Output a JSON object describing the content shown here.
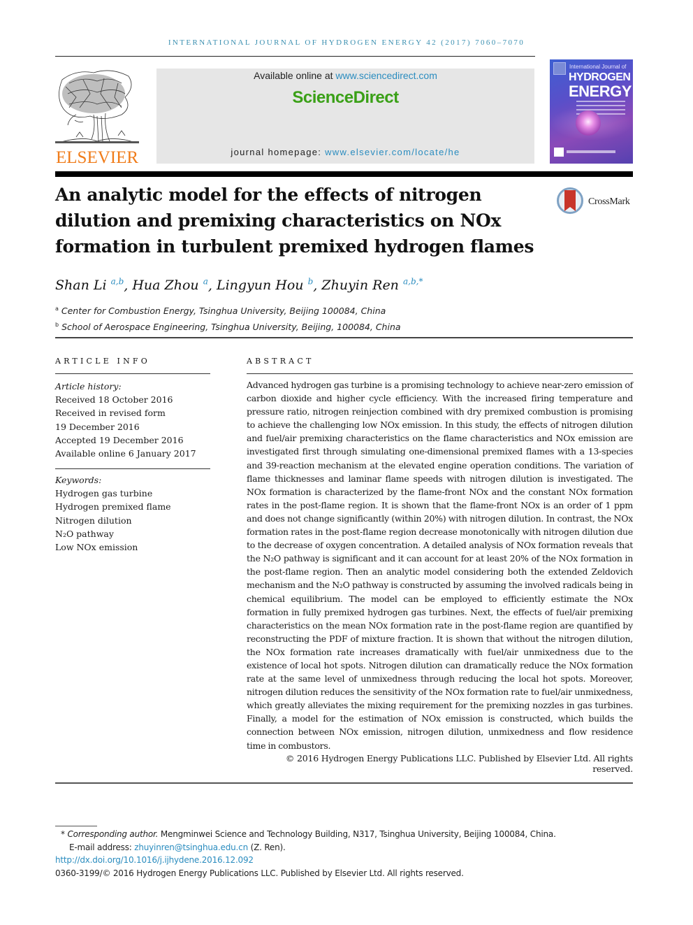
{
  "header": {
    "running_head": "INTERNATIONAL JOURNAL OF HYDROGEN ENERGY 42 (2017) 7060–7070",
    "publisher_logo_text": "ELSEVIER",
    "available_online_prefix": "Available online at ",
    "available_online_link": "www.sciencedirect.com",
    "brand": "ScienceDirect",
    "homepage_prefix": "journal homepage: ",
    "homepage_link": "www.elsevier.com/locate/he",
    "cover": {
      "line1": "International Journal of",
      "line2": "HYDROGEN",
      "line3": "ENERGY"
    },
    "colors": {
      "running_head": "#3a8fb0",
      "elsevier_orange": "#f07c1a",
      "sciencedirect_green": "#3aa017",
      "link_blue": "#2a8cbf"
    }
  },
  "article": {
    "title": "An analytic model for the effects of nitrogen dilution and premixing characteristics on NOx formation in turbulent premixed hydrogen flames",
    "crossmark_label": "CrossMark",
    "authors": [
      {
        "name": "Shan Li",
        "sup": "a,b",
        "sep": ", "
      },
      {
        "name": "Hua Zhou",
        "sup": "a",
        "sep": ", "
      },
      {
        "name": "Lingyun Hou",
        "sup": "b",
        "sep": ", "
      },
      {
        "name": "Zhuyin Ren",
        "sup": "a,b,*",
        "sep": ""
      }
    ],
    "affiliations": [
      {
        "key": "a",
        "text": "Center for Combustion Energy, Tsinghua University, Beijing 100084, China"
      },
      {
        "key": "b",
        "text": "School of Aerospace Engineering, Tsinghua University, Beijing, 100084, China"
      }
    ]
  },
  "article_info": {
    "heading": "ARTICLE INFO",
    "history_label": "Article history:",
    "history": [
      "Received 18 October 2016",
      "Received in revised form",
      "19 December 2016",
      "Accepted 19 December 2016",
      "Available online 6 January 2017"
    ],
    "keywords_label": "Keywords:",
    "keywords": [
      "Hydrogen gas turbine",
      "Hydrogen premixed flame",
      "Nitrogen dilution",
      "N₂O pathway",
      "Low NOx emission"
    ]
  },
  "abstract": {
    "heading": "ABSTRACT",
    "text": "Advanced hydrogen gas turbine is a promising technology to achieve near-zero emission of carbon dioxide and higher cycle efficiency. With the increased firing temperature and pressure ratio, nitrogen reinjection combined with dry premixed combustion is promising to achieve the challenging low NOx emission. In this study, the effects of nitrogen dilution and fuel/air premixing characteristics on the flame characteristics and NOx emission are investigated first through simulating one-dimensional premixed flames with a 13-species and 39-reaction mechanism at the elevated engine operation conditions. The variation of flame thicknesses and laminar flame speeds with nitrogen dilution is investigated. The NOx formation is characterized by the flame-front NOx and the constant NOx formation rates in the post-flame region. It is shown that the flame-front NOx is an order of 1 ppm and does not change significantly (within 20%) with nitrogen dilution. In contrast, the NOx formation rates in the post-flame region decrease monotonically with nitrogen dilution due to the decrease of oxygen concentration. A detailed analysis of NOx formation reveals that the N₂O pathway is significant and it can account for at least 20% of the NOx formation in the post-flame region. Then an analytic model considering both the extended Zeldovich mechanism and the N₂O pathway is constructed by assuming the involved radicals being in chemical equilibrium. The model can be employed to efficiently estimate the NOx formation in fully premixed hydrogen gas turbines. Next, the effects of fuel/air premixing characteristics on the mean NOx formation rate in the post-flame region are quantified by reconstructing the PDF of mixture fraction. It is shown that without the nitrogen dilution, the NOx formation rate increases dramatically with fuel/air unmixedness due to the existence of local hot spots. Nitrogen dilution can dramatically reduce the NOx formation rate at the same level of unmixedness through reducing the local hot spots. Moreover, nitrogen dilution reduces the sensitivity of the NOx formation rate to fuel/air unmixedness, which greatly alleviates the mixing requirement for the premixing nozzles in gas turbines. Finally, a model for the estimation of NOx emission is constructed, which builds the connection between NOx emission, nitrogen dilution, unmixedness and flow residence time in combustors.",
    "copyright": "© 2016 Hydrogen Energy Publications LLC. Published by Elsevier Ltd. All rights reserved."
  },
  "footnotes": {
    "corresponding_label": "Corresponding author.",
    "corresponding_marker": "*",
    "corresponding_text": " Mengminwei Science and Technology Building, N317, Tsinghua University, Beijing 100084, China.",
    "email_prefix": "E-mail address: ",
    "email": "zhuyinren@tsinghua.edu.cn",
    "email_suffix": " (Z. Ren).",
    "doi": "http://dx.doi.org/10.1016/j.ijhydene.2016.12.092",
    "issn_line": "0360-3199/© 2016 Hydrogen Energy Publications LLC. Published by Elsevier Ltd. All rights reserved."
  }
}
